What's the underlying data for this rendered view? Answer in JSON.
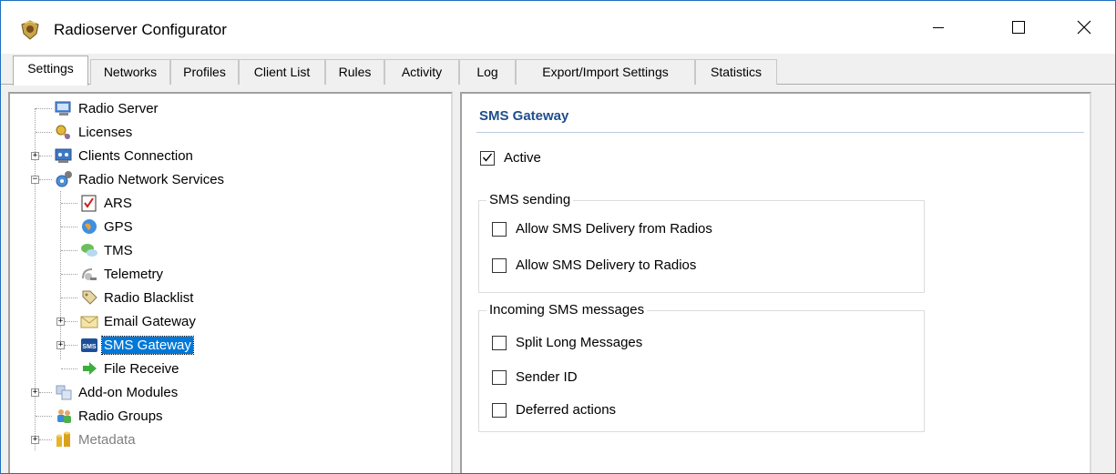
{
  "window": {
    "title": "Radioserver Configurator",
    "accent_border": "#1e6fc0"
  },
  "caption_buttons": {
    "minimize": "minimize-icon",
    "maximize": "maximize-icon",
    "close": "close-icon"
  },
  "tabs": [
    {
      "label": "Settings",
      "active": true
    },
    {
      "label": "Networks"
    },
    {
      "label": "Profiles"
    },
    {
      "label": "Client List"
    },
    {
      "label": "Rules"
    },
    {
      "label": "Activity"
    },
    {
      "label": "Log"
    },
    {
      "label": "Export/Import Settings"
    },
    {
      "label": "Statistics"
    }
  ],
  "tree": {
    "items": [
      {
        "label": "Radio Server",
        "icon": "server-icon"
      },
      {
        "label": "Licenses",
        "icon": "license-key-icon"
      },
      {
        "label": "Clients Connection",
        "icon": "clients-connection-icon"
      },
      {
        "label": "Radio Network Services",
        "icon": "network-services-icon"
      },
      {
        "label": "ARS",
        "icon": "ars-checklist-icon"
      },
      {
        "label": "GPS",
        "icon": "gps-globe-icon"
      },
      {
        "label": "TMS",
        "icon": "tms-chat-icon"
      },
      {
        "label": "Telemetry",
        "icon": "telemetry-satellite-icon"
      },
      {
        "label": "Radio Blacklist",
        "icon": "blacklist-tag-icon"
      },
      {
        "label": "Email Gateway",
        "icon": "email-envelope-icon"
      },
      {
        "label": "SMS Gateway",
        "icon": "sms-icon",
        "selected": true
      },
      {
        "label": "File Receive",
        "icon": "file-receive-arrow-icon"
      },
      {
        "label": "Add-on Modules",
        "icon": "addon-modules-icon"
      },
      {
        "label": "Radio Groups",
        "icon": "radio-groups-icon"
      },
      {
        "label": "Metadata",
        "icon": "metadata-cylinders-icon",
        "disabled": true
      }
    ],
    "selection_color": "#0078d7"
  },
  "detail": {
    "title": "SMS Gateway",
    "title_color": "#1f4e8c",
    "active": {
      "label": "Active",
      "checked": true
    },
    "sms_sending": {
      "title": "SMS sending",
      "options": [
        {
          "label": "Allow SMS Delivery from Radios",
          "checked": false
        },
        {
          "label": "Allow SMS Delivery to Radios",
          "checked": false
        }
      ]
    },
    "incoming": {
      "title": "Incoming SMS messages",
      "options": [
        {
          "label": "Split Long Messages",
          "checked": false
        },
        {
          "label": "Sender ID",
          "checked": false
        },
        {
          "label": "Deferred actions",
          "checked": false
        }
      ]
    }
  }
}
